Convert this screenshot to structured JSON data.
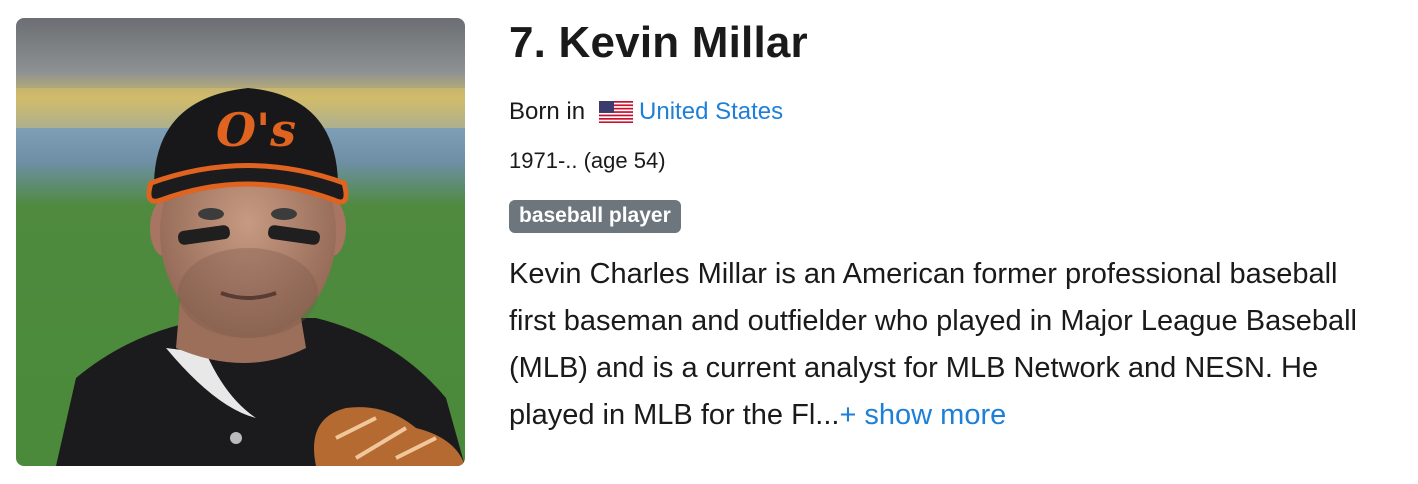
{
  "person": {
    "title": "7. Kevin Millar",
    "born_label": "Born in",
    "country": "United States",
    "flag_icon": "us-flag-icon",
    "dates": "1971-.. (age 54)",
    "tag": "baseball player",
    "description": "Kevin Charles Millar is an American former professional baseball first baseman and outfielder who played in Major League Baseball (MLB) and is a current analyst for MLB Network and NESN. He played in MLB for the Fl...",
    "show_more": "+ show more"
  },
  "colors": {
    "link": "#1e7fd8",
    "tag_bg": "#6d757d"
  }
}
